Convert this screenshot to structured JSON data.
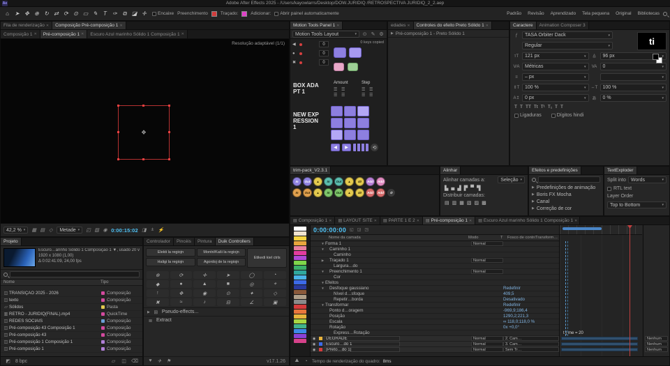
{
  "ui": {
    "caret": "▾",
    "close": "✕",
    "tri_right": "▶",
    "tri_down": "▼",
    "menu": "▤",
    "hamburger": "☰",
    "eye": "◉",
    "link": "∞"
  },
  "colors": {
    "timecode_cyan": "#4fc3f7",
    "value_blue": "#7fb2e0",
    "selection_red": "#e84040",
    "purple_button": "#8d7fe0",
    "fill_red": "#d23c3c",
    "stroke_magenta": "#e040c8"
  },
  "title_bar": {
    "title": "Adobe After Effects 2025 - /Users/kayowlarrs/Desktop/DOW.JURIDIQ /RETROSPECTIVA JURIDIQ_2_2.aep"
  },
  "toolbar": {
    "tools": [
      {
        "name": "home-icon",
        "glyph": "⌂"
      },
      {
        "name": "selection-tool",
        "glyph": "➤"
      },
      {
        "name": "hand-tool",
        "glyph": "✥"
      },
      {
        "name": "zoom-tool",
        "glyph": "⊕"
      },
      {
        "name": "orbit-camera-tool",
        "glyph": "↻"
      },
      {
        "name": "pan-camera-tool",
        "glyph": "⇄"
      },
      {
        "name": "rotation-tool",
        "glyph": "⟳"
      },
      {
        "name": "anchor-point-tool",
        "glyph": "⊙"
      },
      {
        "name": "rectangle-tool",
        "glyph": "▭"
      },
      {
        "name": "pen-tool",
        "glyph": "✎"
      },
      {
        "name": "text-tool",
        "glyph": "T"
      },
      {
        "name": "brush-tool",
        "glyph": "✑"
      },
      {
        "name": "clone-stamp-tool",
        "glyph": "⧉"
      },
      {
        "name": "eraser-tool",
        "glyph": "◪"
      },
      {
        "name": "puppet-pin-tool",
        "glyph": "✛"
      }
    ],
    "snap_label": "Encaixe",
    "fill_label": "Preenchimento",
    "stroke_label": "Traçado:",
    "add_label": "Adicionar:",
    "auto_open_label": "Abrir painel automaticamente",
    "workspaces": [
      "Padrão",
      "Revisão",
      "Aprendizado",
      "Tela pequena",
      "Original",
      "Bibliotecas"
    ]
  },
  "viewer": {
    "queue_tabs": [
      {
        "label": "Fila de renderização"
      },
      {
        "label": "Composição Pré-composição 1",
        "active": true
      }
    ],
    "comp_tabs": [
      {
        "label": "Composição 1"
      },
      {
        "label": "Pré-composição 1",
        "active": true
      },
      {
        "label": "Escuro Azul marinho Sólido 1 Composição 1"
      }
    ],
    "resolution_note": "Resolução adaptável (1/1)",
    "zoom": "42,2 %",
    "resolution": "Metade",
    "timecode": "0:00:15:02",
    "icons_a": [
      {
        "name": "grid-icon",
        "glyph": "▦"
      },
      {
        "name": "guides-icon",
        "glyph": "▤"
      },
      {
        "name": "mask-toggle-icon",
        "glyph": "◇"
      }
    ],
    "icons_b": [
      {
        "name": "roi-icon",
        "glyph": "◰"
      },
      {
        "name": "transparency-grid-icon",
        "glyph": "▨"
      },
      {
        "name": "snapshot-camera-icon",
        "glyph": "◉"
      }
    ],
    "icons_c": [
      {
        "name": "show-channel-icon",
        "glyph": "◨"
      },
      {
        "name": "exposure-icon",
        "glyph": "±"
      },
      {
        "name": "fast-preview-icon",
        "glyph": "⚡"
      }
    ]
  },
  "motion_tools": {
    "tab": "Motion Tools Panel 1",
    "layout_label": "Motion Tools Layout",
    "keys_copied": "0 keys copied",
    "rows": [
      {
        "glyph": "◀",
        "value": "0"
      },
      {
        "glyph": "●",
        "value": "0"
      },
      {
        "glyph": "✖",
        "value": "0"
      }
    ],
    "box_adapt": "BOX ADAPT 1",
    "new_expression": "NEW EXPRESSION 1",
    "amount_label": "Amount",
    "step_label": "Step"
  },
  "effect_controls": {
    "tabs": [
      {
        "label": "edades"
      },
      {
        "label": "Controles do efeito Preto Sólido 1",
        "active": true
      }
    ],
    "breadcrumb": "Pré-composição 1 - Preto Sólido 1"
  },
  "character": {
    "tabs": [
      {
        "label": "Caractere",
        "active": true
      },
      {
        "label": "Animation Composer 3"
      }
    ],
    "font_family": "TASA Orbiter Dack",
    "font_style": "Regular",
    "font_size": "121 px",
    "leading": "96 px",
    "kerning": "Métricas",
    "tracking": "0",
    "stroke_width": "– px",
    "stroke_style": "",
    "v_scale": "100 %",
    "h_scale": "100 %",
    "baseline": "0 px",
    "tsume": "0 %",
    "t_buttons": [
      "T",
      "T",
      "TT",
      "Tt",
      "T¹",
      "T₁",
      "T",
      "T"
    ],
    "ligatures_label": "Ligaduras",
    "hindi_label": "Dígitos hindi",
    "preview_text": "ti"
  },
  "trim_pack": {
    "tab": "trim-pack_V2.3.1",
    "row1": [
      {
        "label": "In",
        "color": "#8f82e0",
        "fg": "#ffffff"
      },
      {
        "label": "Out",
        "color": "#8f82e0",
        "fg": "#ffffff"
      },
      {
        "label": "▲",
        "color": "#e3c94e",
        "fg": "#332b00"
      },
      {
        "label": "In",
        "color": "#5bbcae",
        "fg": "#0d2a26"
      },
      {
        "label": "Out",
        "color": "#5bbcae",
        "fg": "#0d2a26"
      },
      {
        "label": "▲",
        "color": "#e3c94e",
        "fg": "#332b00"
      },
      {
        "label": "40",
        "color": "#e3c94e",
        "fg": "#332b00"
      },
      {
        "label": "Add",
        "color": "#b87fd6",
        "fg": "#ffffff"
      },
      {
        "label": "Add",
        "color": "#e08bc0",
        "fg": "#ffffff"
      }
    ],
    "row2": [
      {
        "label": "In",
        "color": "#e0a04e",
        "fg": "#332200"
      },
      {
        "label": "Out",
        "color": "#e0a04e",
        "fg": "#332200"
      },
      {
        "label": "▲",
        "color": "#e3c94e",
        "fg": "#332b00"
      },
      {
        "label": "In",
        "color": "#7fc66b",
        "fg": "#10300a"
      },
      {
        "label": "Out",
        "color": "#7fc66b",
        "fg": "#10300a"
      },
      {
        "label": "▲",
        "color": "#e3c94e",
        "fg": "#332b00"
      },
      {
        "label": "40",
        "color": "#e3c94e",
        "fg": "#332b00"
      },
      {
        "label": "Add",
        "color": "#d66b6b",
        "fg": "#ffffff"
      },
      {
        "label": "Add",
        "color": "#d66b6b",
        "fg": "#ffffff"
      },
      {
        "label": "⚙",
        "color": "#3a3a3a",
        "fg": "#c8c8c8"
      }
    ]
  },
  "align": {
    "tab": "Alinhar",
    "align_label": "Alinhar camadas a:",
    "align_value": "Seleção",
    "align_icons": [
      "▙",
      "▄",
      "▟",
      "▛",
      "▀",
      "▜"
    ],
    "distribute_label": "Distribuir camadas:",
    "distribute_icons": [
      "▤",
      "▥",
      "▦",
      "▧",
      "▨",
      "▩"
    ]
  },
  "effects_presets": {
    "tab": "Efeitos e predefinições",
    "items": [
      "Predefinições de animação",
      "Boris FX Mocha",
      "Canal",
      "Correção de cor"
    ]
  },
  "text_exploder": {
    "tab": "TextExploder",
    "split_label": "Split into",
    "split_value": "Words",
    "rtl_label": "RTL text",
    "order_label": "Layer Order",
    "order_value": "Top to Bottom"
  },
  "project": {
    "tab": "Projeto",
    "selected_name": "Escuro…arinho Sólido 1 Composição 1 ▼, usado 20 vezes",
    "selected_dims": "1920 x 1080 (1,00)",
    "selected_time": "Δ 0:02:41:09, 24,00 fps",
    "columns": {
      "name": "Nome",
      "type": "Tipo"
    },
    "items": [
      {
        "name": "TRANSIÇÃO 2025 - 2026",
        "type": "Composição",
        "chip": "#d24a9e",
        "icon_glyph": "◫"
      },
      {
        "name": "texto",
        "type": "Composição",
        "chip": "#d24a9e",
        "icon_glyph": "◫"
      },
      {
        "name": "Sólidos",
        "type": "Pasta",
        "chip": "#e3c94e",
        "icon_glyph": "▱"
      },
      {
        "name": "RETRO - JURIDIQ(FINAL).mp4",
        "type": "QuickTime",
        "chip": "#d24a9e",
        "icon_glyph": "▥"
      },
      {
        "name": "REDES SOCIAIS",
        "type": "Composição",
        "chip": "#6b9fd6",
        "icon_glyph": "◫"
      },
      {
        "name": "Pré-composição 43 Composição 1",
        "type": "Composição",
        "chip": "#d24a9e",
        "icon_glyph": "◫"
      },
      {
        "name": "Pré-composição 43",
        "type": "Composição",
        "chip": "#d24a9e",
        "icon_glyph": "◫"
      },
      {
        "name": "Pré-composição 1 Composição 1",
        "type": "Composição",
        "chip": "#b07fd6",
        "icon_glyph": "◫"
      },
      {
        "name": "Pré-composição 1",
        "type": "Composição",
        "chip": "#b07fd6",
        "icon_glyph": "◫"
      }
    ],
    "footer_bpc": "8 bpc"
  },
  "duik": {
    "tabs": [
      {
        "label": "Controlador"
      },
      {
        "label": "Pincéis"
      },
      {
        "label": "Pintura"
      },
      {
        "label": "Duik Controllers",
        "active": true
      }
    ],
    "buttons": [
      "Elekti la regiojn",
      "Montri/Kaŝi la regiojn",
      "Haligi la regiojn",
      "Agordoj de la regiojn"
    ],
    "tag_button": "Etikedi kiel ctrls",
    "icons": [
      {
        "name": "select-region-icon",
        "glyph": "⊕"
      },
      {
        "name": "rotation-controller-icon",
        "glyph": "⟳"
      },
      {
        "name": "crosshair-controller-icon",
        "glyph": "✛"
      },
      {
        "name": "arrow-controller-icon",
        "glyph": "➤"
      },
      {
        "name": "circle-controller-icon",
        "glyph": "◯"
      },
      {
        "name": "pie-controller-icon",
        "glyph": "◔"
      },
      {
        "name": "diamond-controller-icon",
        "glyph": "◆"
      },
      {
        "name": "dot-controller-icon",
        "glyph": "●"
      },
      {
        "name": "triangle-controller-icon",
        "glyph": "▲"
      },
      {
        "name": "square-controller-icon",
        "glyph": "■"
      },
      {
        "name": "ring-controller-icon",
        "glyph": "◎"
      },
      {
        "name": "target-controller-icon",
        "glyph": "⌖"
      },
      {
        "name": "up-arrow-controller-icon",
        "glyph": "↑"
      },
      {
        "name": "move-controller-icon",
        "glyph": "✥"
      },
      {
        "name": "eye-controller-icon",
        "glyph": "◉"
      },
      {
        "name": "pin-controller-icon",
        "glyph": "⊙"
      },
      {
        "name": "star-controller-icon",
        "glyph": "✦"
      },
      {
        "name": "hollow-diamond-controller-icon",
        "glyph": "◇"
      },
      {
        "name": "cross-controller-icon",
        "glyph": "✖"
      },
      {
        "name": "wave-controller-icon",
        "glyph": "≈"
      },
      {
        "name": "audio-controller-icon",
        "glyph": "♪"
      },
      {
        "name": "slider-controller-icon",
        "glyph": "⊟"
      },
      {
        "name": "angle-controller-icon",
        "glyph": "∠"
      },
      {
        "name": "null-controller-icon",
        "glyph": "▣"
      }
    ],
    "pseudo_effects": "Pseudo-effects...",
    "extract": "Extract",
    "footer_icons": [
      {
        "name": "heart-icon",
        "glyph": "♥"
      },
      {
        "name": "plane-icon",
        "glyph": "✈"
      },
      {
        "name": "flag-icon",
        "glyph": "⚑"
      }
    ],
    "version": "v17.1.26"
  },
  "swatches": [
    "#ffffff",
    "#efe3cf",
    "#f5d442",
    "#e8a63c",
    "#e87f9e",
    "#e33c9e",
    "#b04ad6",
    "#7fd64a",
    "#3cb06a",
    "#2fa89e",
    "#4ab4e8",
    "#3c6ae8",
    "#2a3a9e",
    "#8a5a3c",
    "#b0a08a",
    "#8a8a8a",
    "#d63c3c",
    "#e8763c",
    "#e8b43c",
    "#a8d642",
    "#42b48a",
    "#3c8ae8",
    "#8a42d6",
    "#d6428a"
  ],
  "timeline": {
    "tabs": [
      {
        "label": "Composição 1"
      },
      {
        "label": "LAYOUT SITE"
      },
      {
        "label": "PARTE 1 E 2"
      },
      {
        "label": "Pré-composição 1",
        "active": true
      },
      {
        "label": "Escuro Azul marinho Sólido 1 Composição 1"
      }
    ],
    "timecode": "0:00:00:00",
    "columns": {
      "name": "Nome da camada",
      "mode": "Modo",
      "t": "T",
      "trkmat": "Fosco de controle",
      "xform": "Transformar em princip…"
    },
    "rows": [
      {
        "indent": 0,
        "twirl": "▼",
        "label": "Forma 1",
        "mode": "Normal",
        "value": ""
      },
      {
        "indent": 1,
        "twirl": "▼",
        "label": "Caminho 1",
        "mode": "",
        "value": ""
      },
      {
        "indent": 2,
        "twirl": "",
        "label": "Caminho",
        "mode": "",
        "value": ""
      },
      {
        "indent": 1,
        "twirl": "▶",
        "label": "Traçado 1",
        "mode": "Normal",
        "value": ""
      },
      {
        "indent": 2,
        "twirl": "",
        "label": "Largura…do",
        "mode": "",
        "value": ""
      },
      {
        "indent": 1,
        "twirl": "▼",
        "label": "Preenchimento 1",
        "mode": "Normal",
        "value": ""
      },
      {
        "indent": 2,
        "twirl": "",
        "label": "Cor",
        "mode": "",
        "value": ""
      },
      {
        "indent": 0,
        "twirl": "▼",
        "label": "Efeitos",
        "mode": "",
        "value": ""
      },
      {
        "indent": 1,
        "twirl": "▼",
        "label": "Desfoque gaussiano",
        "mode": "",
        "value": "Redefinir"
      },
      {
        "indent": 2,
        "twirl": "",
        "label": "Nível d…sfoque",
        "mode": "",
        "value": "409,5"
      },
      {
        "indent": 2,
        "twirl": "",
        "label": "Repetir…borda",
        "mode": "",
        "value": "Desativado"
      },
      {
        "indent": 0,
        "twirl": "▼",
        "label": "Transformar",
        "mode": "",
        "value": "Redefinir"
      },
      {
        "indent": 1,
        "twirl": "",
        "label": "Ponto d…oragem",
        "mode": "",
        "value": "-969,9;186,4"
      },
      {
        "indent": 1,
        "twirl": "",
        "label": "Posição",
        "mode": "",
        "value": "1290,2;221,3"
      },
      {
        "indent": 1,
        "twirl": "",
        "label": "Escala",
        "mode": "",
        "value": "∞ 118,0;118,0 %"
      },
      {
        "indent": 1,
        "twirl": "",
        "label": "Rotação",
        "mode": "",
        "value": "0x +0,0°"
      },
      {
        "indent": 2,
        "twirl": "",
        "label": "Express…Rotação",
        "mode": "",
        "value": ""
      }
    ],
    "layers": [
      {
        "label": "DEGRADE",
        "chip": "#e8b43c",
        "mode": "Normal",
        "trkmat": "2. Cam…",
        "parent": "Nenhum"
      },
      {
        "label": "Escuro…do 1",
        "chip": "#3c6ae8",
        "mode": "Normal",
        "trkmat": "3. Cam…",
        "parent": "Nenhum"
      },
      {
        "label": "[Preto…do 1]",
        "chip": "#d63c3c",
        "mode": "Normal",
        "trkmat": "Sem Tr…",
        "parent": "Nenhum"
      }
    ],
    "expression_hint": "t ( me = 20",
    "footer_label": "Tempo de renderização do quadro:",
    "footer_value": "8ms"
  }
}
